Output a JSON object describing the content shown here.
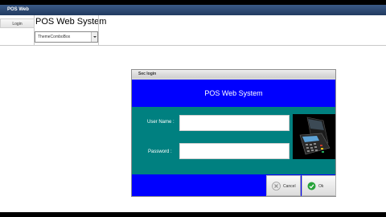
{
  "window": {
    "title": "POS Web"
  },
  "toolbar": {
    "login_tab": "Login",
    "brand": "POS Web System",
    "theme_combo": "ThemeComboBox"
  },
  "dialog": {
    "title": "Sec login",
    "header": "POS Web System",
    "username_label": "User Name :",
    "password_label": "Password :",
    "username_value": "",
    "password_value": "",
    "cancel_label": "Cancel",
    "ok_label": "Ok"
  },
  "colors": {
    "header": "#0000ff",
    "body": "#008080",
    "titlebar": "#2b4770"
  },
  "icons": {
    "cancel": "cancel-circle-icon",
    "ok": "check-circle-icon",
    "image": "card-terminal-image"
  }
}
